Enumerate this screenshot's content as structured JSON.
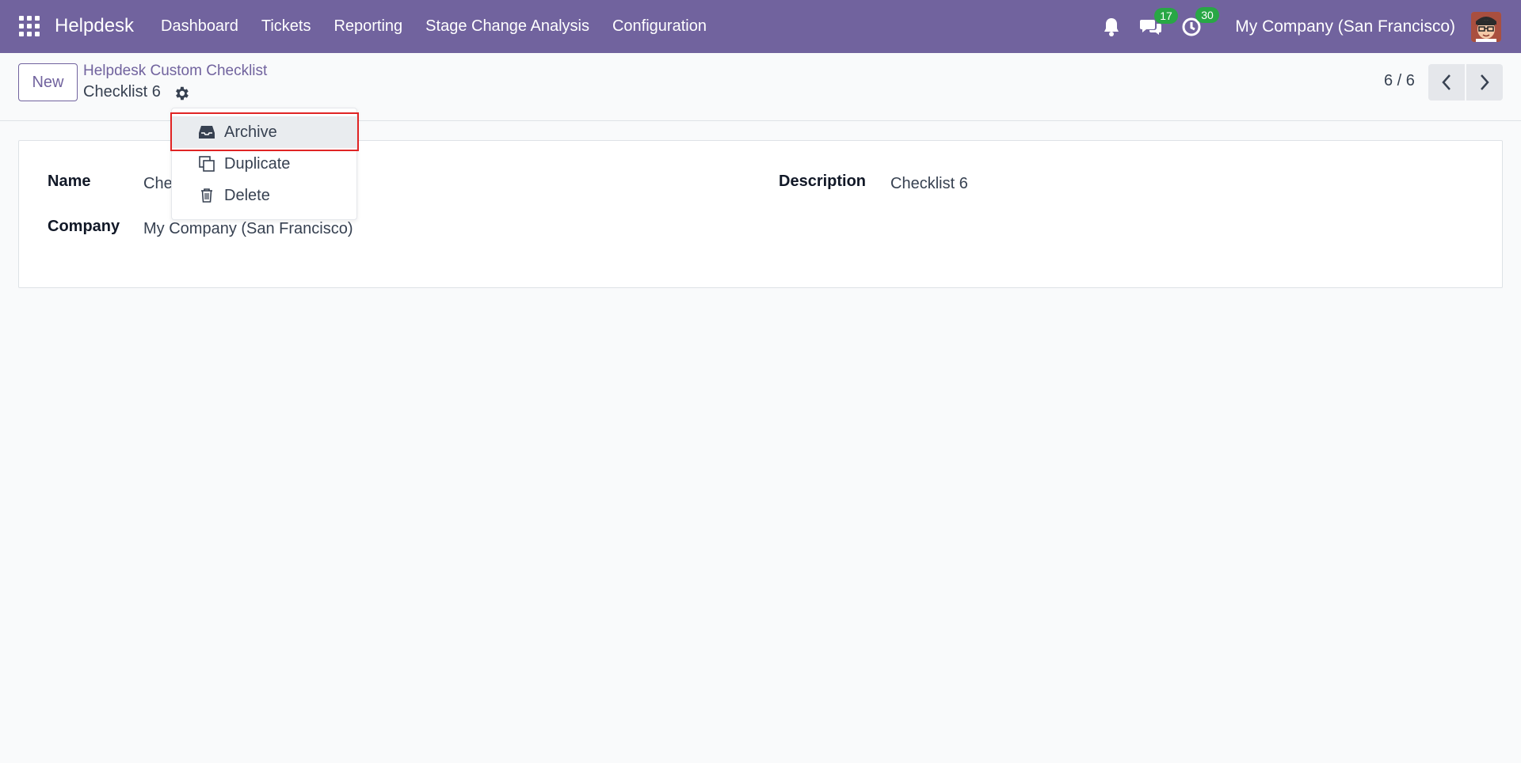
{
  "navbar": {
    "brand": "Helpdesk",
    "menu": [
      "Dashboard",
      "Tickets",
      "Reporting",
      "Stage Change Analysis",
      "Configuration"
    ],
    "messages_count": "17",
    "activities_count": "30",
    "company": "My Company (San Francisco)"
  },
  "control_panel": {
    "new_label": "New",
    "breadcrumb_parent": "Helpdesk Custom Checklist",
    "breadcrumb_current": "Checklist 6",
    "pager": "6 / 6"
  },
  "dropdown": {
    "items": [
      {
        "label": "Archive",
        "icon": "archive-icon"
      },
      {
        "label": "Duplicate",
        "icon": "duplicate-icon"
      },
      {
        "label": "Delete",
        "icon": "trash-icon"
      }
    ]
  },
  "form": {
    "name_label": "Name",
    "name_value": "Che",
    "company_label": "Company",
    "company_value": "My Company (San Francisco)",
    "description_label": "Description",
    "description_value": "Checklist 6"
  },
  "colors": {
    "brand": "#71639e",
    "badge": "#28a745",
    "highlight": "#e02424"
  }
}
